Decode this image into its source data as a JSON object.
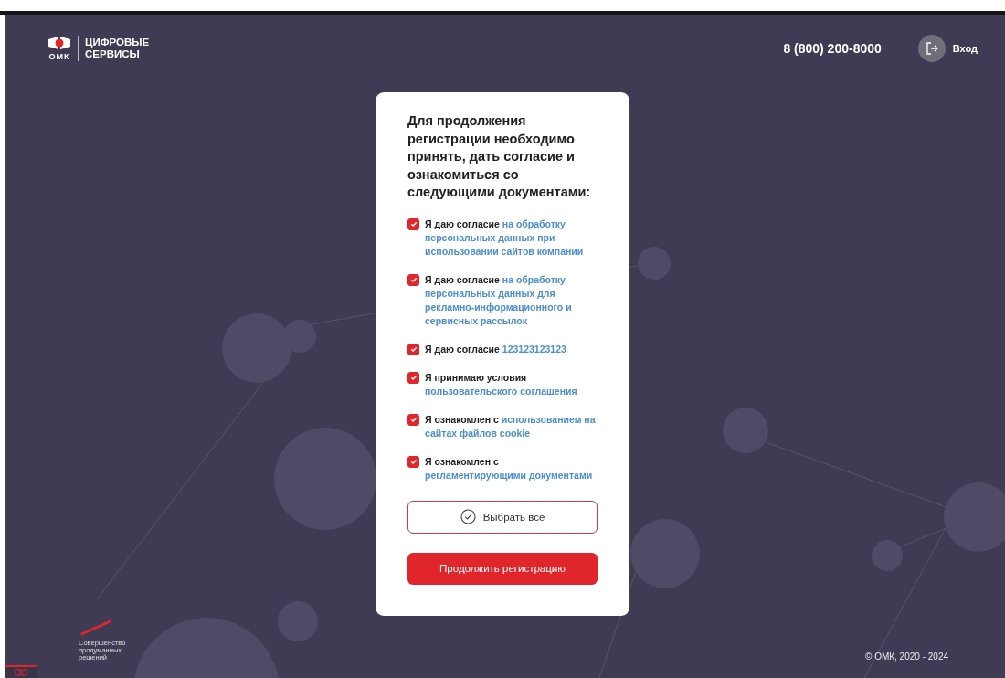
{
  "logo": {
    "brand": "ОМК",
    "title_lines": [
      "ЦИФРОВЫЕ",
      "СЕРВИСЫ"
    ]
  },
  "header": {
    "phone": "8 (800) 200-8000",
    "login": "Вход"
  },
  "card": {
    "heading": "Для продолжения регистрации необходимо принять, дать согласие и ознакомиться со следующими документами:",
    "consents": [
      {
        "prefix": "Я даю согласие",
        "link": "на обработку персональных данных при использовании сайтов компании",
        "checked": true
      },
      {
        "prefix": "Я даю согласие",
        "link": "на обработку персональных данных для рекламно-информационного и сервисных рассылок",
        "checked": true
      },
      {
        "prefix": "Я даю согласие",
        "link": "123123123123",
        "checked": true
      },
      {
        "prefix": "Я принимаю условия",
        "link": "пользовательского соглашения",
        "checked": true
      },
      {
        "prefix": "Я ознакомлен с",
        "link": "использованием на сайтах файлов cookie",
        "checked": true
      },
      {
        "prefix": "Я ознакомлен с",
        "link": "регламентирующими документами",
        "checked": true
      }
    ],
    "select_all": "Выбрать всё",
    "continue": "Продолжить регистрацию"
  },
  "slogan_lines": [
    "Совершенство",
    "продуманных",
    "решений"
  ],
  "copyright": "© ОМК, 2020 - 2024"
}
